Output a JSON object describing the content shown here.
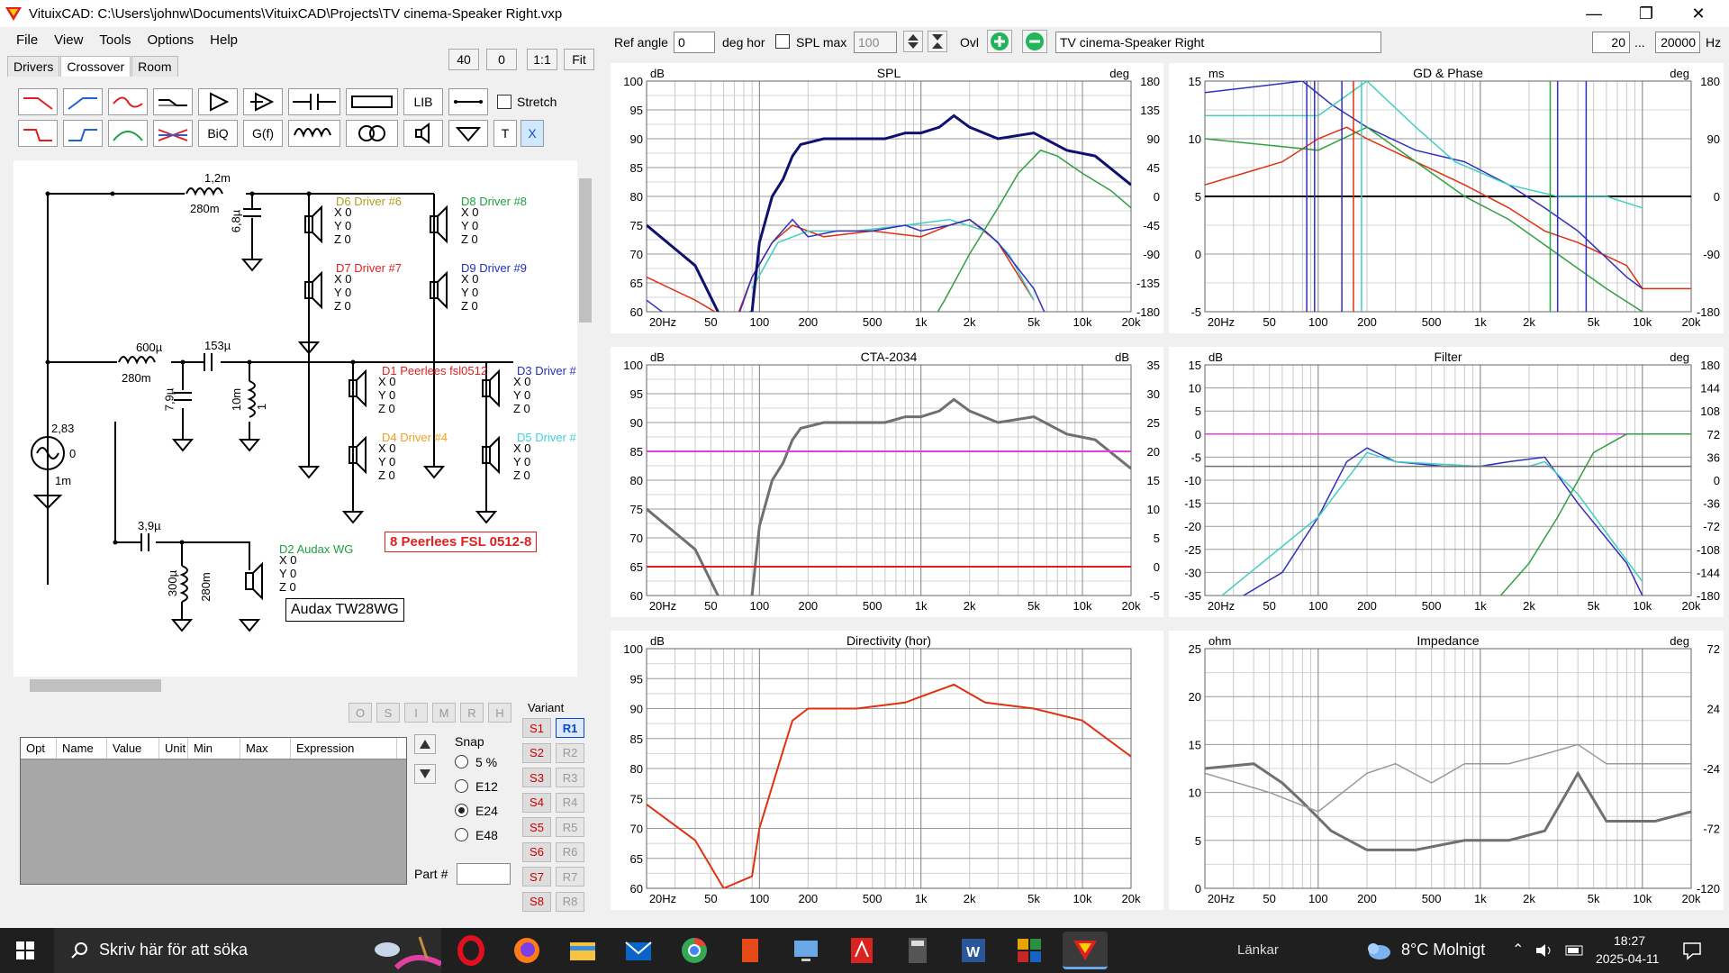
{
  "window": {
    "title": "VituixCAD: C:\\Users\\johnw\\Documents\\VituixCAD\\Projects\\TV cinema-Speaker Right.vxp"
  },
  "menu": [
    "File",
    "View",
    "Tools",
    "Options",
    "Help"
  ],
  "tabs": [
    "Drivers",
    "Crossover",
    "Room"
  ],
  "zoom": {
    "z40": "40",
    "z0": "0",
    "one": "1:1",
    "fit": "Fit"
  },
  "toolbar": {
    "lib": "LIB",
    "biq": "BiQ",
    "gf": "G(f)",
    "t": "T",
    "x": "X",
    "stretch": "Stretch"
  },
  "top": {
    "ref_angle_label": "Ref angle",
    "ref_angle": "0",
    "deg_hor": "deg hor",
    "spl_max": "SPL max",
    "spl_max_value": "100",
    "ovl": "Ovl",
    "title_field": "TV cinema-Speaker Right",
    "f_low": "20",
    "dots": "...",
    "f_high": "20000",
    "hz": "Hz"
  },
  "schematic": {
    "c1_val": "1,2m",
    "c1_r": "280m",
    "c2": "6,8µ",
    "d6": "D6 Driver #6",
    "d8": "D8 Driver #8",
    "d7": "D7 Driver #7",
    "d9": "D9 Driver #9",
    "l2": "600µ",
    "l2_r": "280m",
    "c3": "153µ",
    "c4": "7,9µ",
    "l3": "10m",
    "l3_r": "1",
    "d1": "D1 Peerlees fsl0512",
    "d3": "D3 Driver #",
    "d4": "D4 Driver #4",
    "d5": "D5 Driver #",
    "src": "2,83",
    "src0": "0",
    "src_r": "1m",
    "c5": "3,9µ",
    "l4": "300µ",
    "l4_r": "280m",
    "d2": "D2 Audax WG",
    "note_red": "8 Peerlees FSL 0512-8",
    "note_black": "Audax TW28WG",
    "xyz": [
      "X 0",
      "Y 0",
      "Z 0"
    ]
  },
  "flags": [
    "O",
    "S",
    "I",
    "M",
    "R",
    "H"
  ],
  "table": {
    "headers": [
      "Opt",
      "Name",
      "Value",
      "Unit",
      "Min",
      "Max",
      "Expression"
    ]
  },
  "snap": {
    "title": "Snap",
    "options": [
      "5 %",
      "E12",
      "E24",
      "E48"
    ],
    "selected": "E24",
    "part_label": "Part #"
  },
  "variant": {
    "title": "Variant",
    "s": [
      "S1",
      "S2",
      "S3",
      "S4",
      "S5",
      "S6",
      "S7",
      "S8"
    ],
    "r": [
      "R1",
      "R2",
      "R3",
      "R4",
      "R5",
      "R6",
      "R7",
      "R8"
    ],
    "selected": "R1"
  },
  "charts": {
    "spl": {
      "title": "SPL",
      "left_unit": "dB",
      "right_unit": "deg",
      "left_ticks": [
        "100",
        "95",
        "90",
        "85",
        "80",
        "75",
        "70",
        "65",
        "60"
      ],
      "right_ticks": [
        "180",
        "135",
        "90",
        "45",
        "0",
        "-45",
        "-90",
        "-135",
        "-180"
      ]
    },
    "gd": {
      "title": "GD & Phase",
      "left_unit": "ms",
      "right_unit": "deg",
      "left_ticks": [
        "15",
        "10",
        "5",
        "0",
        "-5"
      ],
      "right_ticks": [
        "180",
        "90",
        "0",
        "-90",
        "-180"
      ]
    },
    "cta": {
      "title": "CTA-2034",
      "left_unit": "dB",
      "right_unit": "dB",
      "left_ticks": [
        "100",
        "95",
        "90",
        "85",
        "80",
        "75",
        "70",
        "65",
        "60"
      ],
      "right_ticks": [
        "35",
        "30",
        "25",
        "20",
        "15",
        "10",
        "5",
        "0",
        "-5"
      ]
    },
    "filter": {
      "title": "Filter",
      "left_unit": "dB",
      "right_unit": "deg",
      "left_ticks": [
        "15",
        "10",
        "5",
        "0",
        "-5",
        "-10",
        "-15",
        "-20",
        "-25",
        "-30",
        "-35"
      ],
      "right_ticks": [
        "180",
        "144",
        "108",
        "72",
        "36",
        "0",
        "-36",
        "-72",
        "-108",
        "-144",
        "-180"
      ]
    },
    "dir": {
      "title": "Directivity (hor)",
      "left_unit": "dB",
      "right_unit": "",
      "left_ticks": [
        "100",
        "95",
        "90",
        "85",
        "80",
        "75",
        "70",
        "65",
        "60"
      ],
      "right_ticks": []
    },
    "imp": {
      "title": "Impedance",
      "left_unit": "ohm",
      "right_unit": "deg",
      "left_ticks": [
        "25",
        "20",
        "15",
        "10",
        "5",
        "0"
      ],
      "right_ticks": [
        "72",
        "24",
        "-24",
        "-72",
        "-120"
      ]
    },
    "x_ticks": [
      "20Hz",
      "50",
      "100",
      "200",
      "500",
      "1k",
      "2k",
      "5k",
      "10k",
      "20k"
    ]
  },
  "taskbar": {
    "search": "Skriv här för att söka",
    "links": "Länkar",
    "weather": "8°C  Molnigt",
    "time": "18:27",
    "date": "2025-04-11"
  },
  "colors": {
    "navy": "#10106e",
    "red": "#e03010",
    "blue": "#3030c0",
    "cyan": "#40d0c0",
    "green": "#30a040",
    "gray": "#707070",
    "magenta": "#e040e0"
  }
}
